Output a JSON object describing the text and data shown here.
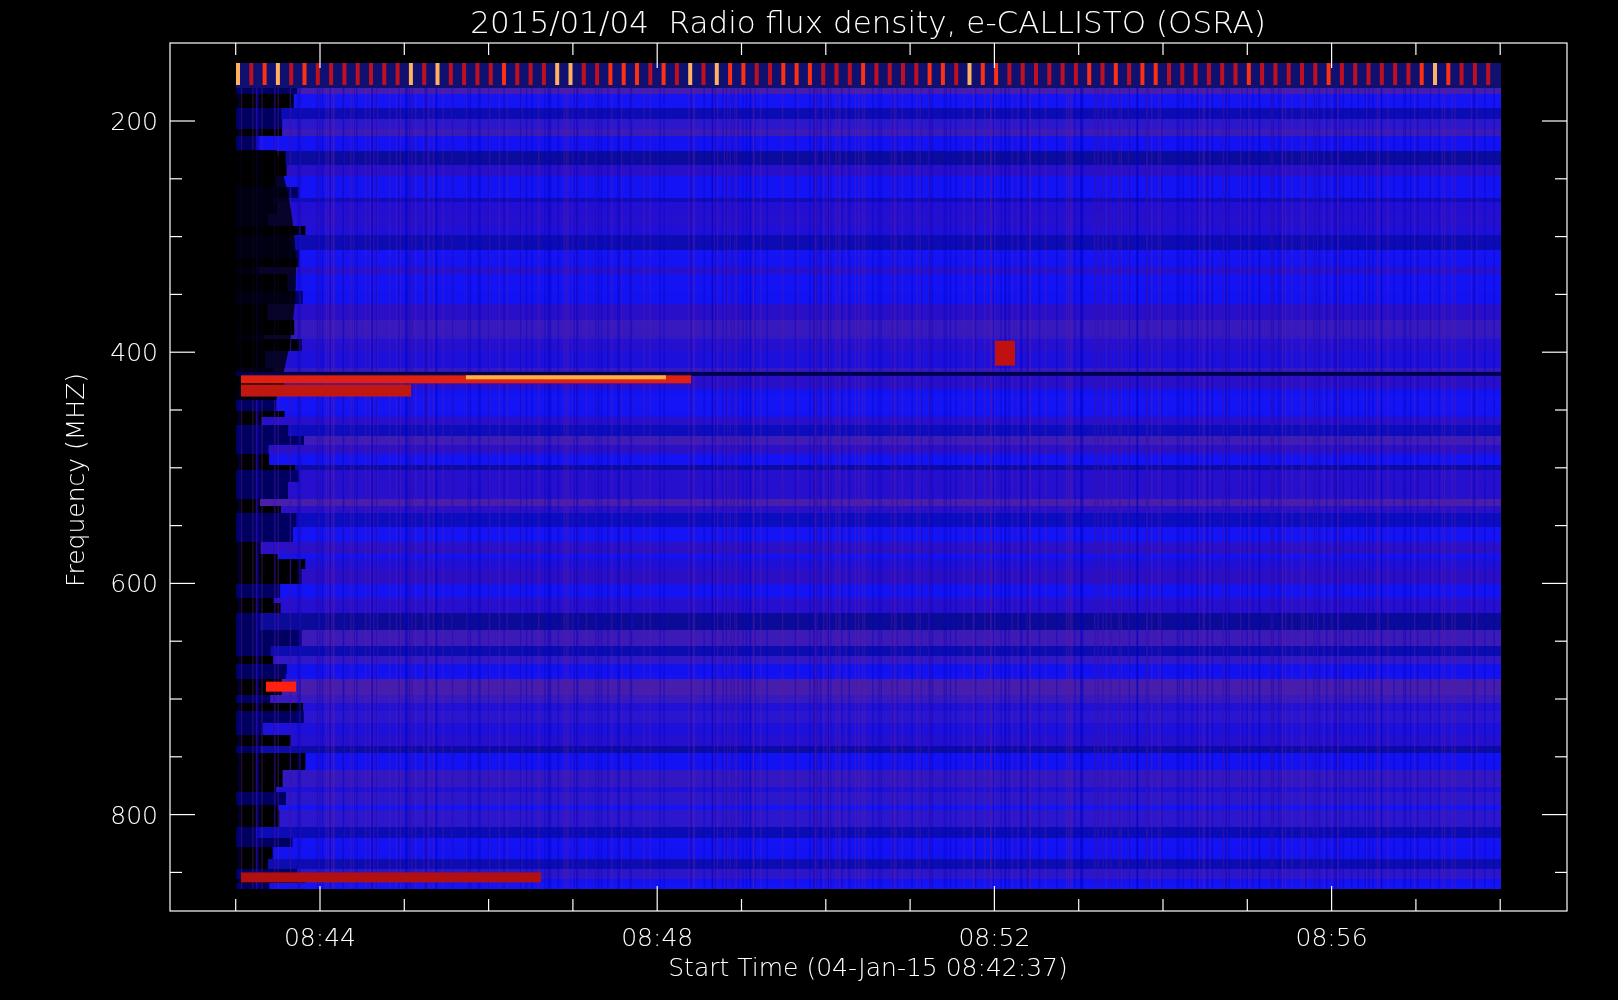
{
  "title": "2015/01/04  Radio flux density, e-CALLISTO (OSRA)",
  "ylabel": "Frequency (MHZ)",
  "xlabel": "Start Time (04-Jan-15 08:42:37)",
  "y_ticks": [
    "200",
    "400",
    "600",
    "800"
  ],
  "x_ticks": [
    "08:44",
    "08:48",
    "08:52",
    "08:56"
  ]
}
